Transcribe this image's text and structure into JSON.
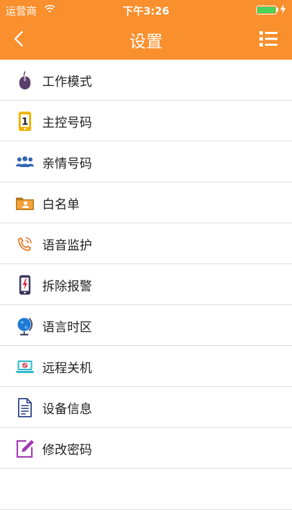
{
  "status": {
    "carrier": "运营商",
    "time": "下午3:26"
  },
  "header": {
    "title": "设置"
  },
  "menu_items": [
    {
      "label": "工作模式",
      "icon": "mouse-icon"
    },
    {
      "label": "主控号码",
      "icon": "phone-number-icon"
    },
    {
      "label": "亲情号码",
      "icon": "family-icon"
    },
    {
      "label": "白名单",
      "icon": "contact-folder-icon"
    },
    {
      "label": "语音监护",
      "icon": "voice-phone-icon"
    },
    {
      "label": "拆除报警",
      "icon": "tamper-alarm-icon"
    },
    {
      "label": "语言时区",
      "icon": "globe-icon"
    },
    {
      "label": "远程关机",
      "icon": "remote-shutdown-icon"
    },
    {
      "label": "设备信息",
      "icon": "document-icon"
    },
    {
      "label": "修改密码",
      "icon": "edit-icon"
    }
  ],
  "colors": {
    "accent": "#f98f2d"
  }
}
